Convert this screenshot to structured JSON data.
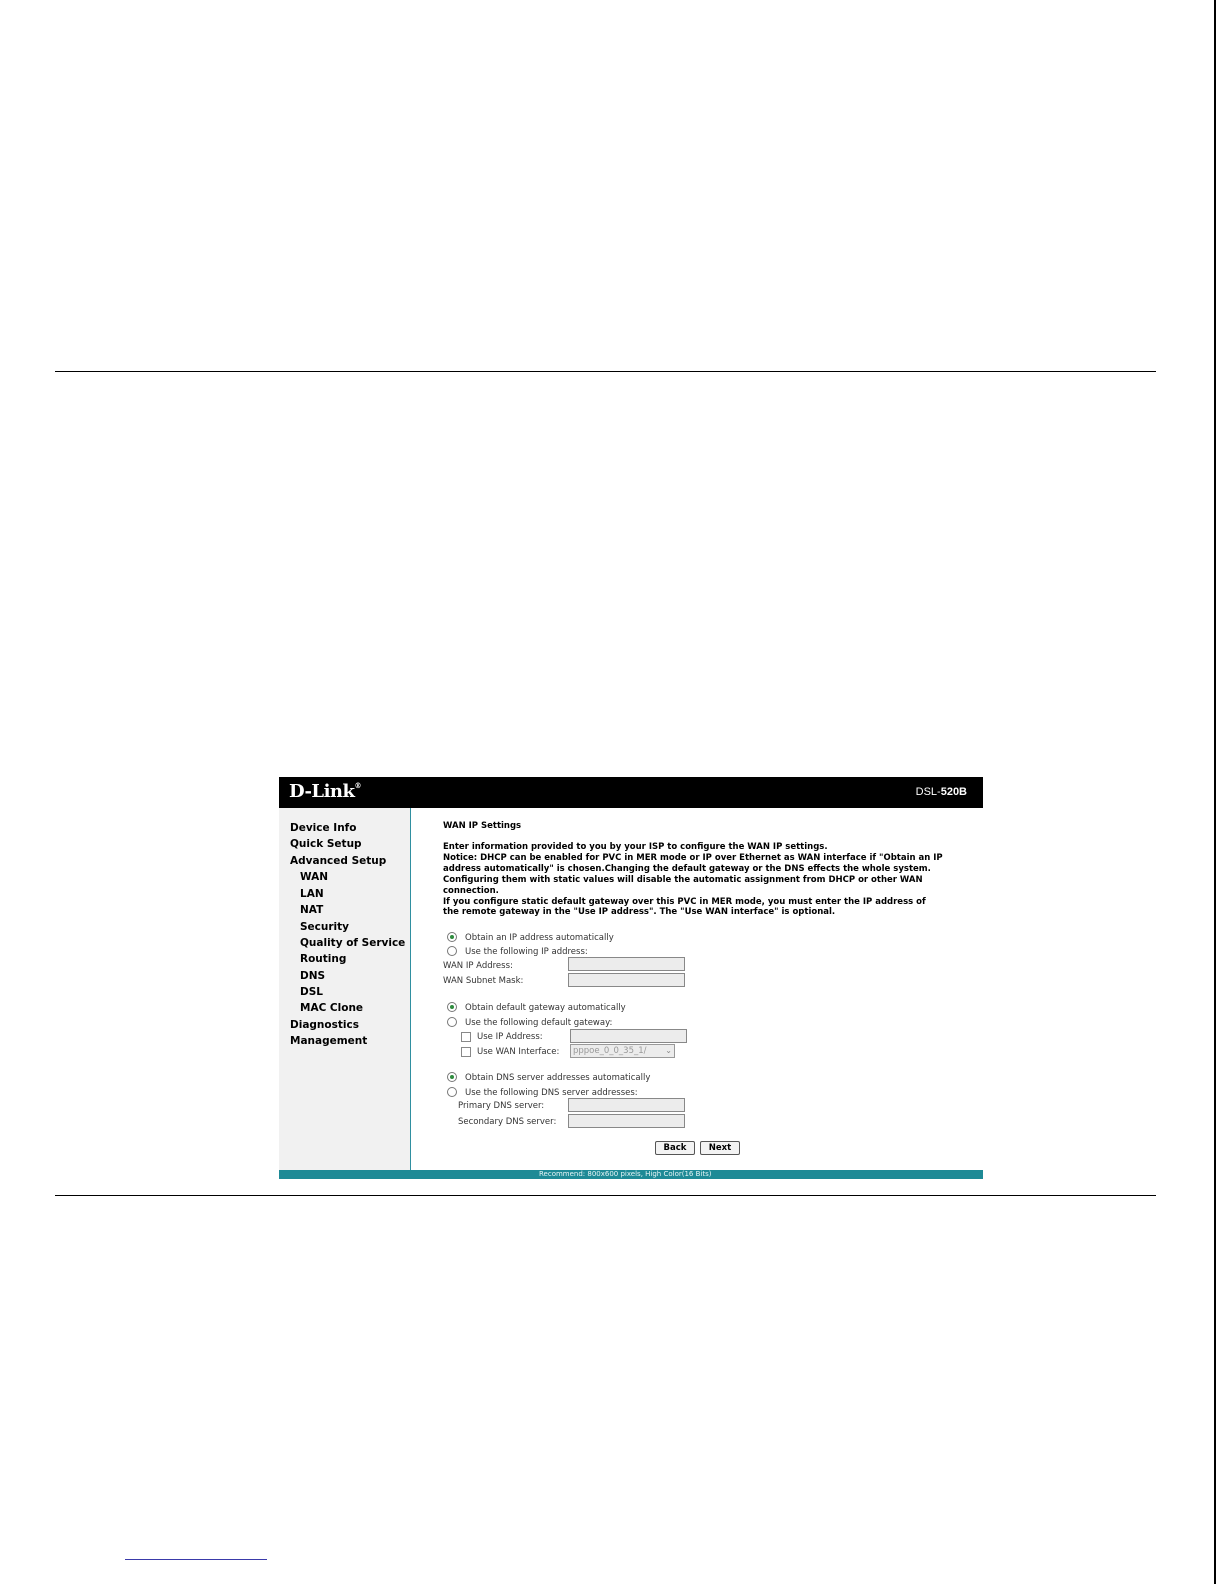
{
  "window": {
    "model_prefix": "DSL-",
    "model_number": "520B",
    "logo": "D-Link"
  },
  "sidebar": {
    "items": [
      {
        "label": "Device Info"
      },
      {
        "label": "Quick Setup"
      },
      {
        "label": "Advanced Setup"
      },
      {
        "label": "WAN"
      },
      {
        "label": "LAN"
      },
      {
        "label": "NAT"
      },
      {
        "label": "Security"
      },
      {
        "label": "Quality of Service"
      },
      {
        "label": "Routing"
      },
      {
        "label": "DNS"
      },
      {
        "label": "DSL"
      },
      {
        "label": "MAC Clone"
      },
      {
        "label": "Diagnostics"
      },
      {
        "label": "Management"
      }
    ]
  },
  "main": {
    "title": "WAN IP Settings",
    "description": [
      "Enter information provided to you by your ISP to configure the WAN IP settings.",
      "Notice: DHCP can be enabled for PVC in MER mode or IP over Ethernet as WAN interface if \"Obtain an IP",
      "address automatically\" is chosen.Changing the default gateway or the DNS effects the whole system.",
      "Configuring them with static values will disable the automatic assignment from DHCP or other WAN",
      "connection.",
      "If you configure static default gateway over this PVC in MER mode, you must enter the IP address of",
      "the remote gateway in the \"Use IP address\". The \"Use WAN interface\" is optional."
    ],
    "ip": {
      "auto_label": "Obtain an IP address automatically",
      "manual_label": "Use the following IP address:",
      "wan_ip_label": "WAN IP Address:",
      "subnet_label": "WAN Subnet Mask:",
      "selected": "auto"
    },
    "gateway": {
      "auto_label": "Obtain default gateway automatically",
      "manual_label": "Use the following default gateway:",
      "use_ip_label": "Use IP Address:",
      "use_wan_label": "Use WAN Interface:",
      "wan_interface_value": "pppoe_0_0_35_1/",
      "selected": "auto"
    },
    "dns": {
      "auto_label": "Obtain DNS server addresses automatically",
      "manual_label": "Use the following DNS server addresses:",
      "primary_label": "Primary DNS server:",
      "secondary_label": "Secondary DNS server:",
      "selected": "auto"
    },
    "buttons": {
      "back": "Back",
      "next": "Next"
    }
  },
  "footer": {
    "text": "Recommend: 800x600 pixels, High Color(16 Bits)"
  },
  "colors": {
    "header_bg": "#000000",
    "footer_bar": "#1e8a96",
    "radio_selected": "#2e8b3e"
  }
}
